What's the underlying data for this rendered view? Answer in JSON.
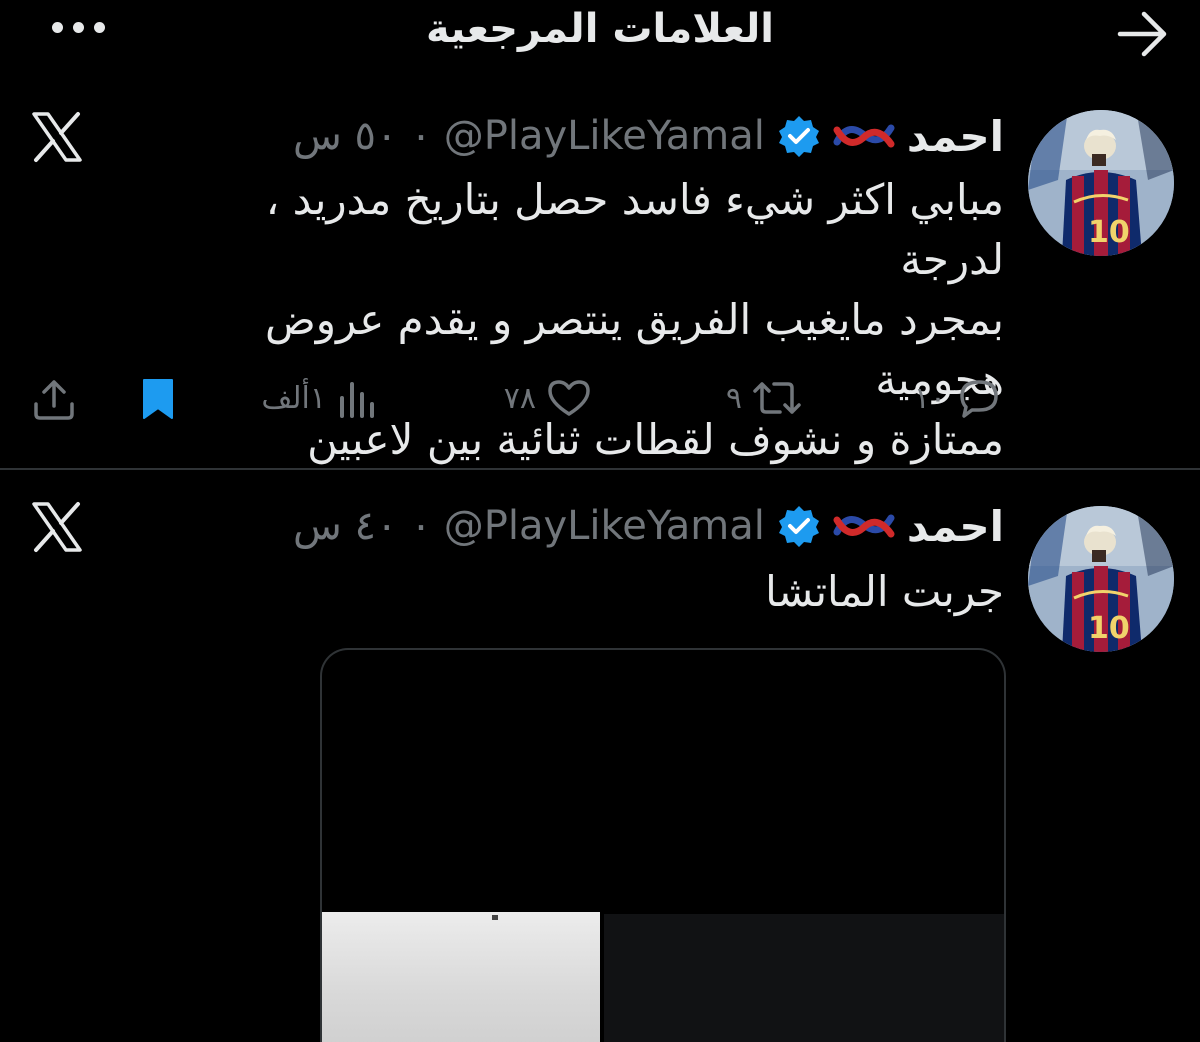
{
  "header": {
    "title": "العلامات المرجعية",
    "back_icon": "arrow-right-icon",
    "more_icon": "more-horizontal-icon"
  },
  "colors": {
    "background": "#000000",
    "text": "#e7e9ea",
    "muted": "#71767b",
    "verified": "#1d9bf0",
    "bookmark_active": "#1d9bf0",
    "divider": "#2f3336"
  },
  "tweets": [
    {
      "name": "احمد",
      "handle": "@PlayLikeYamal",
      "time": "٠ ٥٠ س",
      "text_lines": [
        "مبابي اكثر شيء فاسد حصل بتاريخ مدريد ، لدرجة",
        "بمجرد مايغيب الفريق ينتصر و يقدم عروض هجومية",
        "ممتازة و نشوف لقطات ثنائية بين لاعبين"
      ],
      "actions": {
        "replies": "١٠",
        "retweets": "٩",
        "likes": "٧٨",
        "views": "١ألف"
      },
      "bookmarked": true
    },
    {
      "name": "احمد",
      "handle": "@PlayLikeYamal",
      "time": "٠ ٤٠ س",
      "text_lines": [
        "جربت الماتشا"
      ]
    }
  ]
}
